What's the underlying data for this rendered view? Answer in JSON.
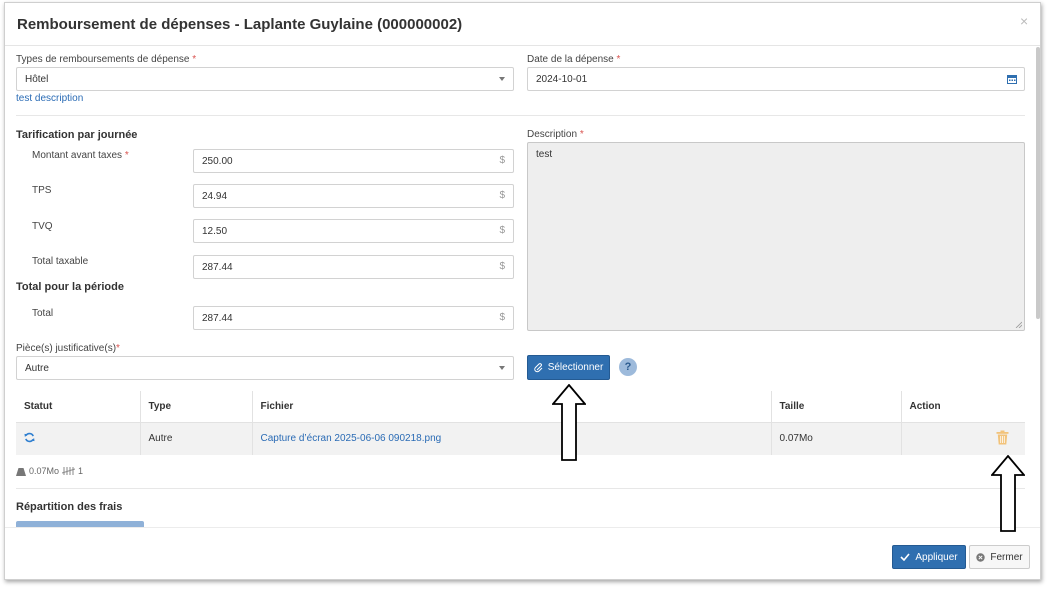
{
  "dialog": {
    "title": "Remboursement de dépenses - Laplante Guylaine (000000002)",
    "close_icon": "×"
  },
  "expense_type": {
    "label": "Types de remboursements de dépense",
    "required_mark": "*",
    "value": "Hôtel",
    "description_link": "test description"
  },
  "expense_date": {
    "label": "Date de la dépense",
    "required_mark": "*",
    "value": "2024-10-01",
    "icon": "calendar-icon"
  },
  "daily_rate": {
    "section_title": "Tarification par journée",
    "fields": [
      {
        "label": "Montant avant taxes",
        "required_mark": "*",
        "value": "250.00",
        "unit": "$"
      },
      {
        "label": "TPS",
        "required_mark": "",
        "value": "24.94",
        "unit": "$"
      },
      {
        "label": "TVQ",
        "required_mark": "",
        "value": "12.50",
        "unit": "$"
      },
      {
        "label": "Total taxable",
        "required_mark": "",
        "value": "287.44",
        "unit": "$"
      }
    ]
  },
  "period_total": {
    "section_title": "Total pour la période",
    "label": "Total",
    "value": "287.44",
    "unit": "$"
  },
  "description": {
    "label": "Description",
    "required_mark": "*",
    "value": "test"
  },
  "attachments": {
    "label": "Pièce(s) justificative(s)",
    "required_mark": "*",
    "type_value": "Autre",
    "select_button": "Sélectionner",
    "help_icon": "?",
    "columns": [
      "Statut",
      "Type",
      "Fichier",
      "Taille",
      "Action"
    ],
    "rows": [
      {
        "status_icon": "refresh-icon",
        "type": "Autre",
        "file": "Capture d’écran 2025-06-06 090218.png",
        "size": "0.07Mo",
        "action_icon": "trash-icon"
      }
    ],
    "summary_size": "0.07Mo",
    "summary_count": "1"
  },
  "distribution": {
    "section_title": "Répartition des frais"
  },
  "footer": {
    "apply_label": "Appliquer",
    "close_label": "Fermer"
  },
  "colors": {
    "primary": "#2f6fb0",
    "link": "#2a6bb5",
    "required": "#d9534f",
    "trash": "#f2c37a"
  }
}
